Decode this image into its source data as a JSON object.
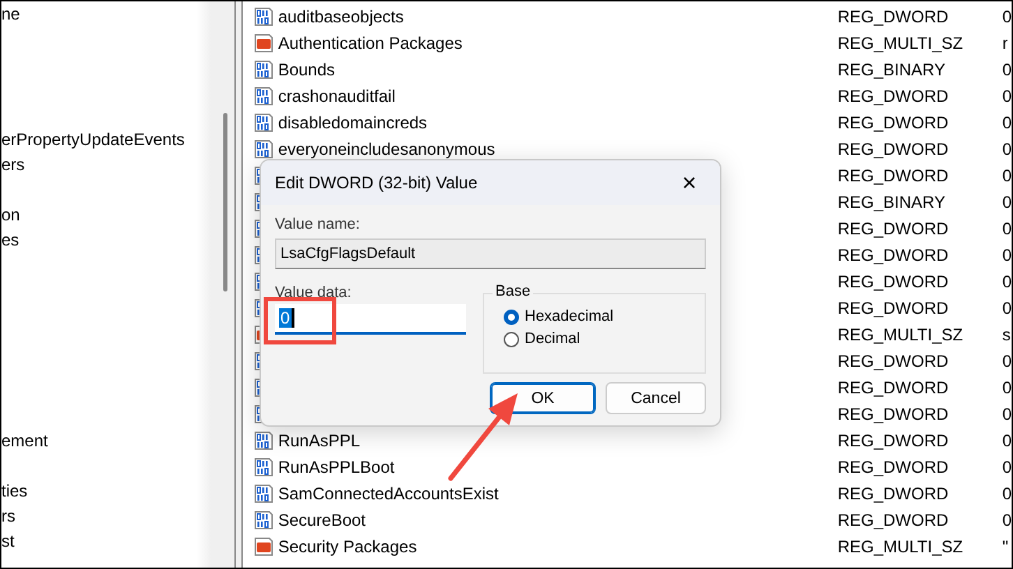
{
  "tree": {
    "items": [
      {
        "label": "ne"
      },
      {
        "label": "erPropertyUpdateEvents"
      },
      {
        "label": "ers"
      },
      {
        "label": "on"
      },
      {
        "label": "es"
      },
      {
        "label": "ement"
      },
      {
        "label": "ties"
      },
      {
        "label": "rs"
      },
      {
        "label": "st"
      }
    ]
  },
  "values": [
    {
      "kind": "binary",
      "name": "auditbaseobjects",
      "type": "REG_DWORD",
      "data": "0"
    },
    {
      "kind": "string",
      "name": "Authentication Packages",
      "type": "REG_MULTI_SZ",
      "data": "r"
    },
    {
      "kind": "binary",
      "name": "Bounds",
      "type": "REG_BINARY",
      "data": "0"
    },
    {
      "kind": "binary",
      "name": "crashonauditfail",
      "type": "REG_DWORD",
      "data": "0"
    },
    {
      "kind": "binary",
      "name": "disabledomaincreds",
      "type": "REG_DWORD",
      "data": "0"
    },
    {
      "kind": "binary",
      "name": "everyoneincludesanonymous",
      "type": "REG_DWORD",
      "data": "0"
    },
    {
      "kind": "binary",
      "type": "REG_DWORD",
      "data": "0"
    },
    {
      "kind": "binary",
      "type": "REG_BINARY",
      "data": "0"
    },
    {
      "kind": "binary",
      "type": "REG_DWORD",
      "data": "0"
    },
    {
      "kind": "binary",
      "type": "REG_DWORD",
      "data": "0"
    },
    {
      "kind": "binary",
      "type": "REG_DWORD",
      "data": "0"
    },
    {
      "kind": "binary",
      "type": "REG_DWORD",
      "data": "0"
    },
    {
      "kind": "string",
      "type": "REG_MULTI_SZ",
      "data": "s"
    },
    {
      "kind": "binary",
      "type": "REG_DWORD",
      "data": "0"
    },
    {
      "kind": "binary",
      "type": "REG_DWORD",
      "data": "0"
    },
    {
      "kind": "binary",
      "type": "REG_DWORD",
      "data": "0"
    },
    {
      "kind": "binary",
      "name": "RunAsPPL",
      "type": "REG_DWORD",
      "data": "0"
    },
    {
      "kind": "binary",
      "name": "RunAsPPLBoot",
      "type": "REG_DWORD",
      "data": "0"
    },
    {
      "kind": "binary",
      "name": "SamConnectedAccountsExist",
      "type": "REG_DWORD",
      "data": "0"
    },
    {
      "kind": "binary",
      "name": "SecureBoot",
      "type": "REG_DWORD",
      "data": "0"
    },
    {
      "kind": "string",
      "name": "Security Packages",
      "type": "REG_MULTI_SZ",
      "data": "\""
    }
  ],
  "dialog": {
    "title": "Edit DWORD (32-bit) Value",
    "close": "×",
    "value_name_label": "Value name:",
    "value_name": "LsaCfgFlagsDefault",
    "value_data_label": "Value data:",
    "value_data": "0",
    "base": {
      "legend": "Base",
      "options": [
        {
          "label": "Hexadecimal",
          "selected": true
        },
        {
          "label": "Decimal",
          "selected": false
        }
      ]
    },
    "buttons": [
      {
        "label": "OK",
        "focused": true
      },
      {
        "label": "Cancel",
        "focused": false
      }
    ]
  }
}
